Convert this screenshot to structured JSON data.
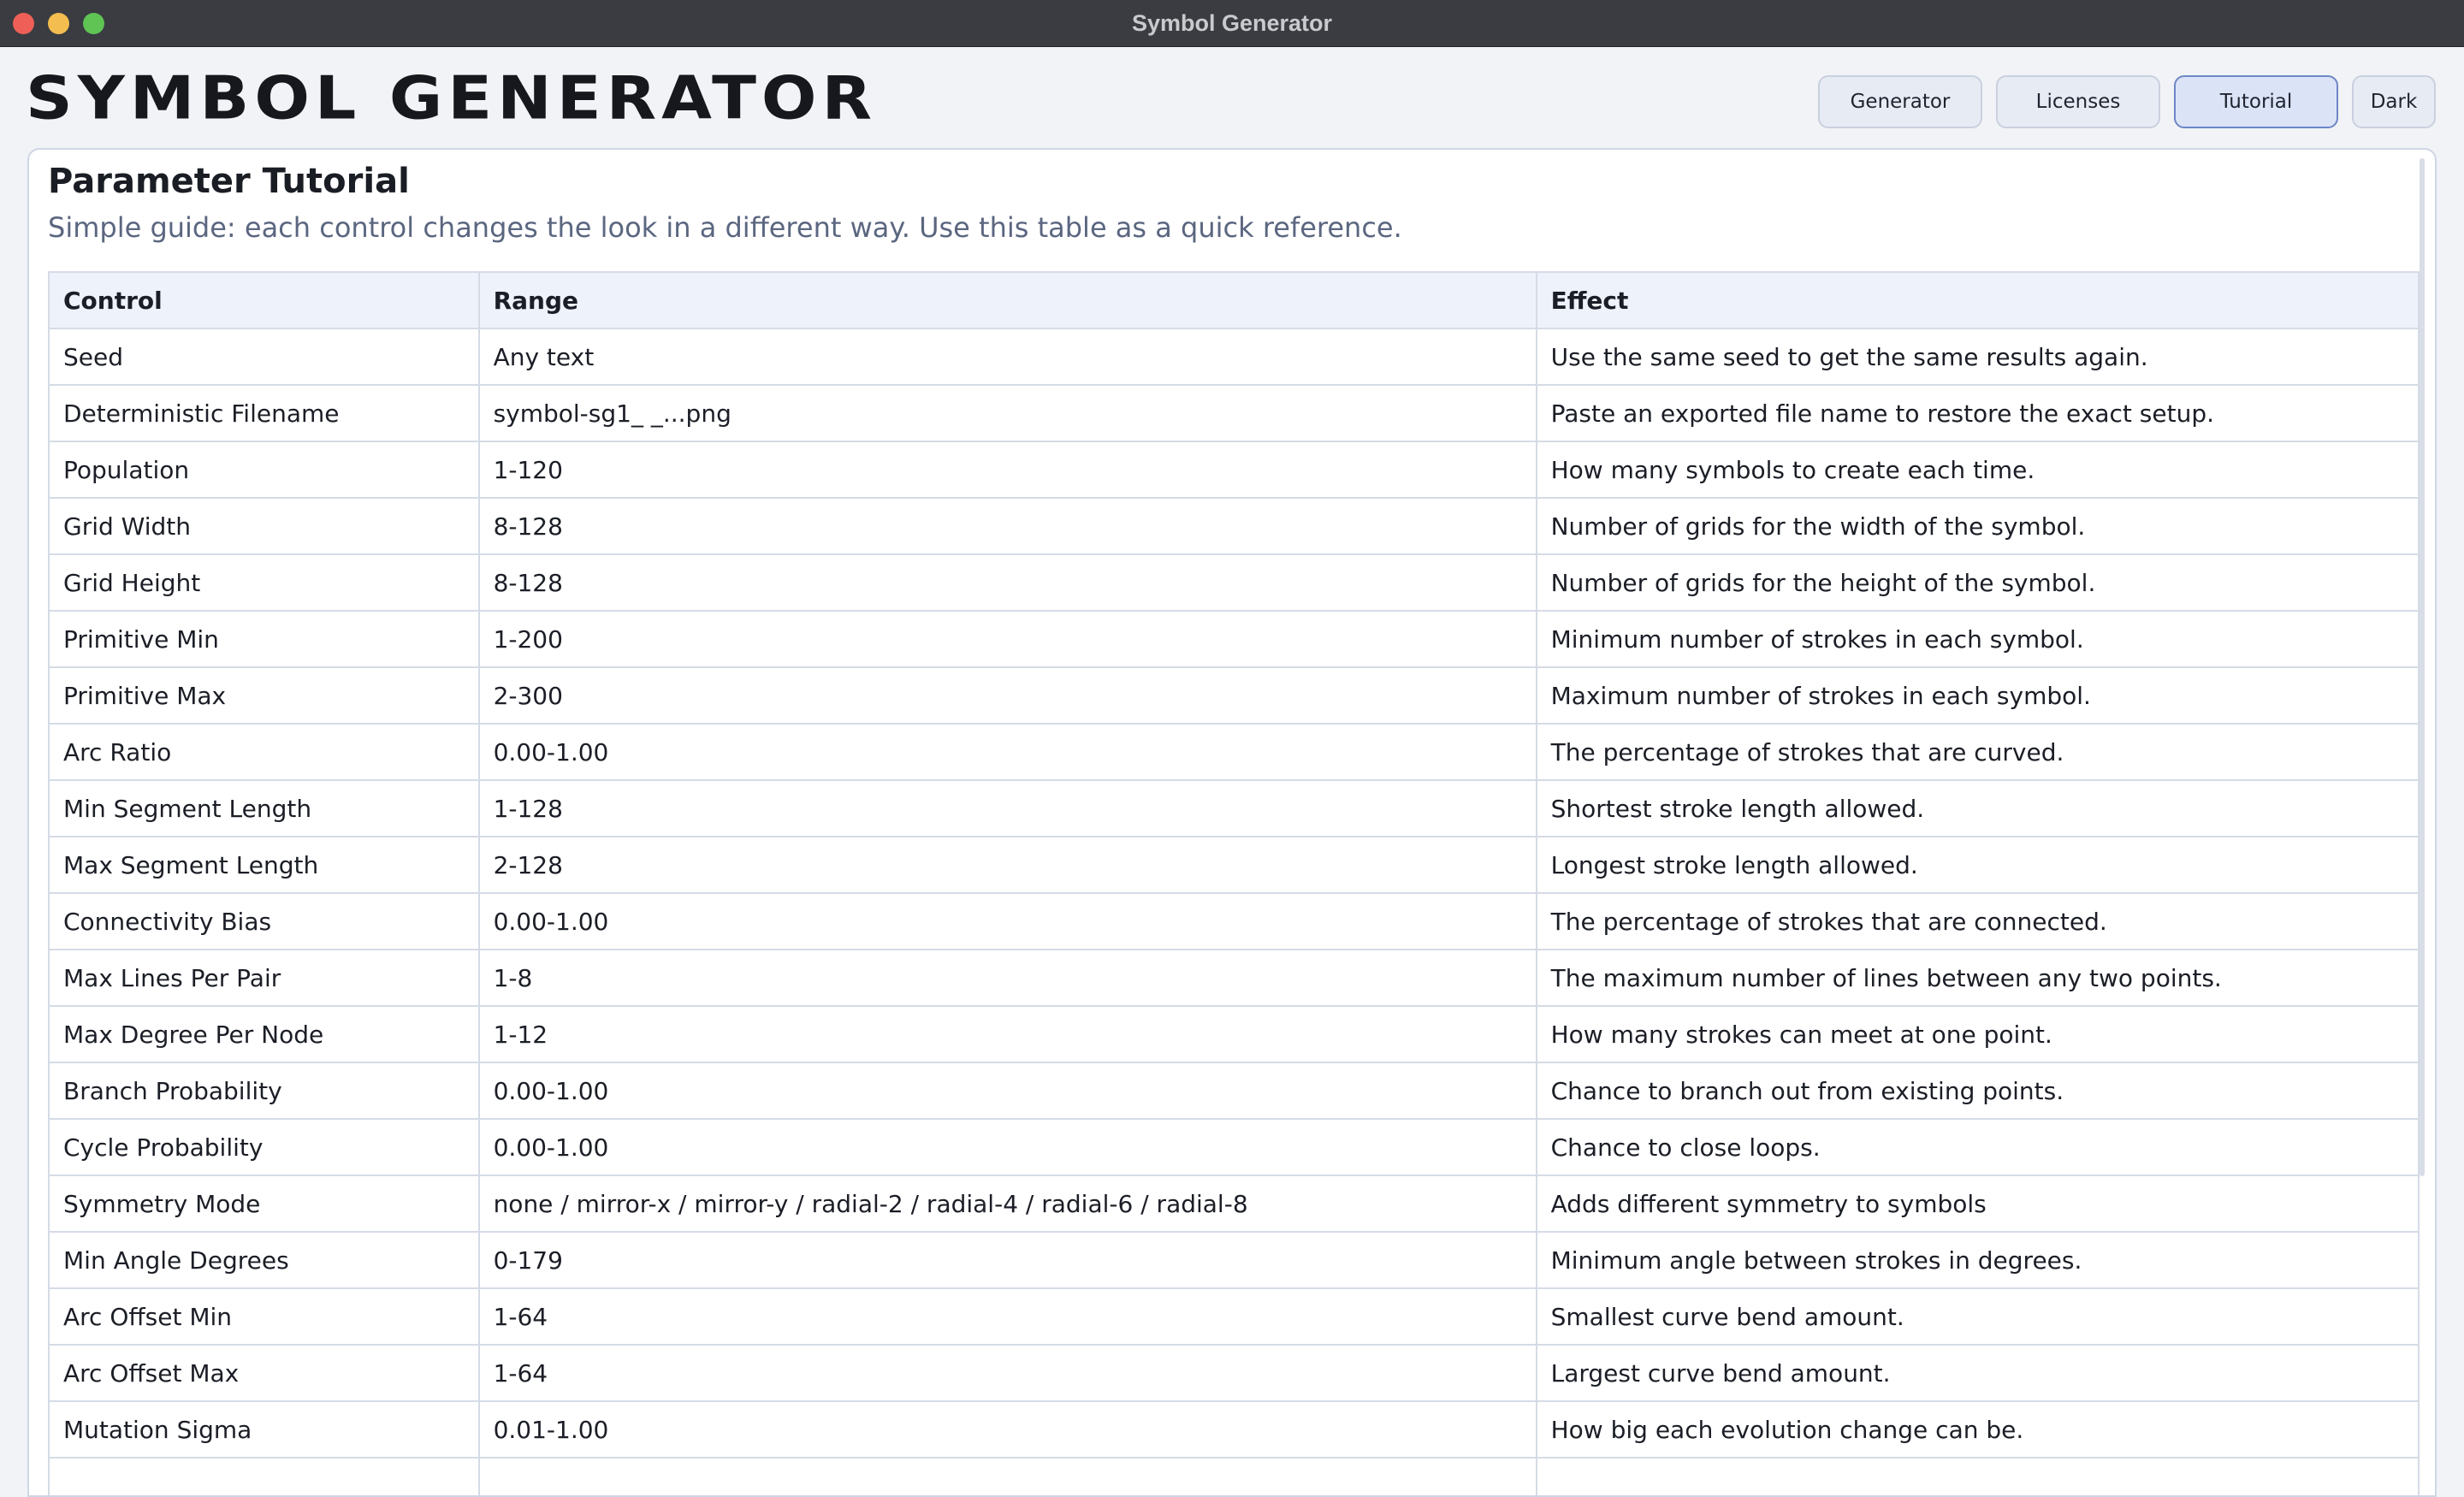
{
  "window": {
    "title": "Symbol Generator"
  },
  "header": {
    "logo_text": "SYMBOL GENERATOR",
    "nav": [
      {
        "label": "Generator"
      },
      {
        "label": "Licenses"
      },
      {
        "label": "Tutorial"
      },
      {
        "label": "Dark"
      }
    ],
    "active_tab": "Tutorial"
  },
  "panel": {
    "title": "Parameter Tutorial",
    "subtitle": "Simple guide: each control changes the look in a different way. Use this table as a quick reference.",
    "columns": [
      "Control",
      "Range",
      "Effect"
    ],
    "rows": [
      [
        "Seed",
        "Any text",
        "Use the same seed to get the same results again."
      ],
      [
        "Deterministic Filename",
        "symbol-sg1_ _...png",
        "Paste an exported file name to restore the exact setup."
      ],
      [
        "Population",
        "1-120",
        "How many symbols to create each time."
      ],
      [
        "Grid Width",
        "8-128",
        "Number of grids for the width of the symbol."
      ],
      [
        "Grid Height",
        "8-128",
        "Number of grids for the height of the symbol."
      ],
      [
        "Primitive Min",
        "1-200",
        "Minimum number of strokes in each symbol."
      ],
      [
        "Primitive Max",
        "2-300",
        "Maximum number of strokes in each symbol."
      ],
      [
        "Arc Ratio",
        "0.00-1.00",
        "The percentage of strokes that are curved."
      ],
      [
        "Min Segment Length",
        "1-128",
        "Shortest stroke length allowed."
      ],
      [
        "Max Segment Length",
        "2-128",
        "Longest stroke length allowed."
      ],
      [
        "Connectivity Bias",
        "0.00-1.00",
        "The percentage of strokes that are connected."
      ],
      [
        "Max Lines Per Pair",
        "1-8",
        "The maximum number of lines between any two points."
      ],
      [
        "Max Degree Per Node",
        "1-12",
        "How many strokes can meet at one point."
      ],
      [
        "Branch Probability",
        "0.00-1.00",
        "Chance to branch out from existing points."
      ],
      [
        "Cycle Probability",
        "0.00-1.00",
        "Chance to close loops."
      ],
      [
        "Symmetry Mode",
        "none / mirror-x / mirror-y / radial-2 / radial-4 / radial-6 / radial-8",
        "Adds different symmetry to symbols"
      ],
      [
        "Min Angle Degrees",
        "0-179",
        "Minimum angle between strokes in degrees."
      ],
      [
        "Arc Offset Min",
        "1-64",
        "Smallest curve bend amount."
      ],
      [
        "Arc Offset Max",
        "1-64",
        "Largest curve bend amount."
      ],
      [
        "Mutation Sigma",
        "0.01-1.00",
        "How big each evolution change can be."
      ],
      [
        "",
        "",
        ""
      ]
    ]
  }
}
